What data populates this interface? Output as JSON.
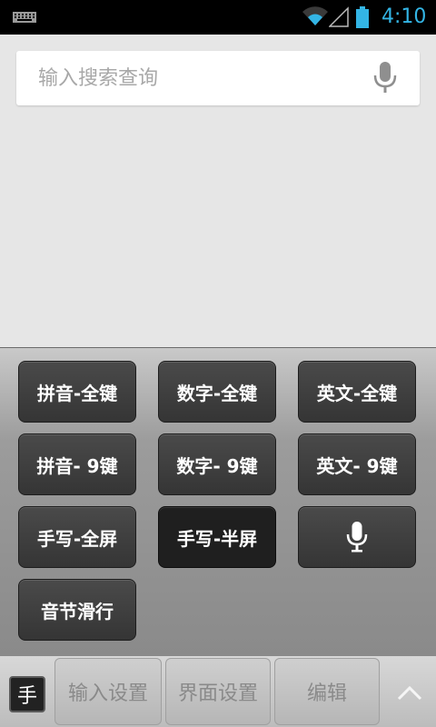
{
  "status": {
    "time": "4:10"
  },
  "search": {
    "placeholder": "输入搜索查询",
    "value": ""
  },
  "keyboard_modes": [
    {
      "label": "拼音-全键"
    },
    {
      "label": "数字-全键"
    },
    {
      "label": "英文-全键"
    },
    {
      "label": "拼音- 9键"
    },
    {
      "label": "数字- 9键"
    },
    {
      "label": "英文- 9键"
    },
    {
      "label": "手写-全屏"
    },
    {
      "label": "手写-半屏",
      "selected": true
    },
    {
      "label": ""
    },
    {
      "label": "音节滑行"
    }
  ],
  "bottom_bar": {
    "handwriting_badge": "手",
    "tabs": [
      "输入设置",
      "界面设置",
      "编辑"
    ]
  },
  "colors": {
    "clock": "#33b5e5"
  },
  "icons": [
    "keyboard-icon",
    "wifi-icon",
    "signal-icon",
    "battery-icon",
    "microphone-icon",
    "chevron-up-icon"
  ]
}
